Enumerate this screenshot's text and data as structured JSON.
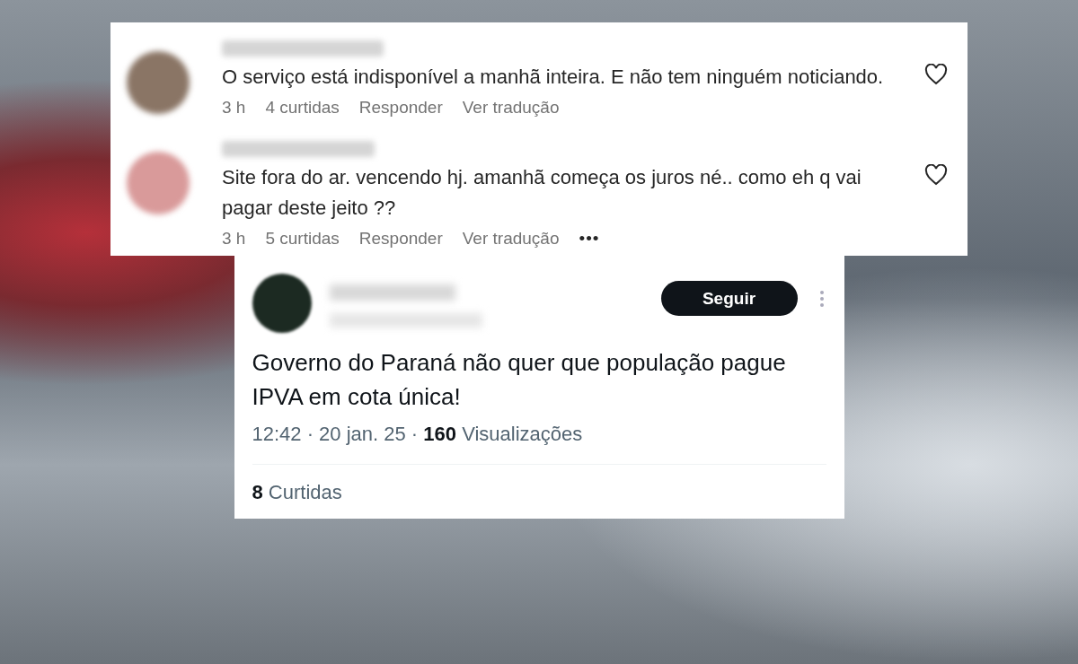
{
  "comments": [
    {
      "text": "O serviço está indisponível a manhã inteira. E não tem ninguém noticiando.",
      "time": "3 h",
      "likes": "4 curtidas",
      "reply": "Responder",
      "translate": "Ver tradução"
    },
    {
      "text": "Site fora do ar. vencendo hj. amanhã começa os juros né.. como eh q vai pagar deste jeito ??",
      "time": "3 h",
      "likes": "5 curtidas",
      "reply": "Responder",
      "translate": "Ver tradução",
      "more": "•••"
    }
  ],
  "post": {
    "follow_button": "Seguir",
    "text": "Governo do Paraná não quer que população pague IPVA em cota única!",
    "meta": "12:42 · 20 jan. 25 · **160** Visualizações",
    "likes": "**8** Curtidas"
  }
}
